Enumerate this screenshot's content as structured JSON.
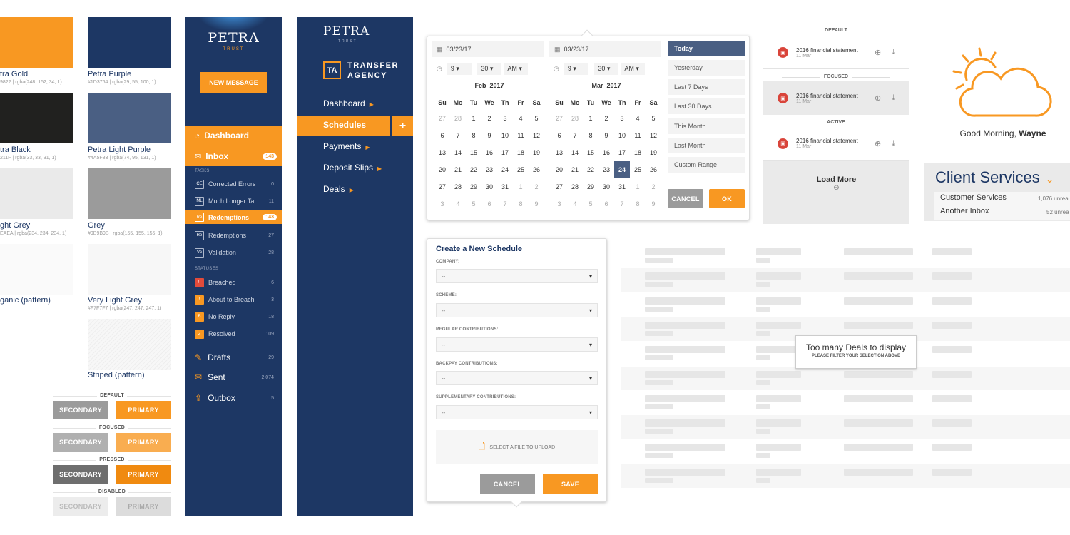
{
  "colors": {
    "gold": "#F89822",
    "purple": "#1D3764",
    "black": "#21211F",
    "light_purple": "#4A5F83",
    "light_grey": "#EAEAEA",
    "grey": "#9B9B9B",
    "very_light_grey": "#F7F7F7"
  },
  "swatches": [
    {
      "name": "tra Gold",
      "sub": "9822 | rgba(248, 152, 34, 1)"
    },
    {
      "name": "Petra Purple",
      "sub": "#1D3764 | rgba(29, 55, 100, 1)"
    },
    {
      "name": "tra Black",
      "sub": "211F | rgba(33, 33, 31, 1)"
    },
    {
      "name": "Petra Light Purple",
      "sub": "#4A5F83 | rgba(74, 95, 131, 1)"
    },
    {
      "name": "ght Grey",
      "sub": "EAEA | rgba(234, 234, 234, 1)"
    },
    {
      "name": "Grey",
      "sub": "#9B9B9B | rgba(155, 155, 155, 1)"
    },
    {
      "name": "ganic (pattern)"
    },
    {
      "name": "Very Light Grey",
      "sub": "#F7F7F7 | rgba(247, 247, 247, 1)"
    },
    {
      "name": "Striped (pattern)"
    }
  ],
  "buttons": {
    "states": [
      "DEFAULT",
      "FOCUSED",
      "PRESSED",
      "DISABLED"
    ],
    "secondary": "SECONDARY",
    "primary": "PRIMARY"
  },
  "sidebar1": {
    "logo": "PETRA",
    "logo_sub": "TRUST",
    "new_message": "NEW MESSAGE",
    "dashboard": "Dashboard",
    "inbox": "Inbox",
    "inbox_count": "143",
    "tasks_label": "TASKS",
    "statuses_label": "STATUSES",
    "tasks": [
      {
        "icon": "CE",
        "label": "Corrected Errors",
        "count": "0"
      },
      {
        "icon": "ML",
        "label": "Much Longer Ta",
        "count": "11"
      },
      {
        "icon": "Re",
        "label": "Redemptions",
        "count": "143",
        "active": true
      },
      {
        "icon": "Re",
        "label": "Redemptions",
        "count": "27"
      },
      {
        "icon": "Va",
        "label": "Validation",
        "count": "28"
      }
    ],
    "statuses": [
      {
        "icon": "!!",
        "label": "Breached",
        "count": "6",
        "color": "#e24b3b"
      },
      {
        "icon": "!",
        "label": "About to Breach",
        "count": "3",
        "color": "#F89822"
      },
      {
        "icon": "B",
        "label": "No Reply",
        "count": "18",
        "color": "#F89822"
      },
      {
        "icon": "✓",
        "label": "Resolved",
        "count": "109",
        "color": "#F89822"
      }
    ],
    "folders": [
      {
        "label": "Drafts",
        "count": "29"
      },
      {
        "label": "Sent",
        "count": "2,074"
      },
      {
        "label": "Outbox",
        "count": "5"
      }
    ]
  },
  "sidebar2": {
    "logo": "PETRA",
    "logo_sub": "TRUST",
    "ta": "TA",
    "agency1": "TRANSFER",
    "agency2": "AGENCY",
    "items": [
      "Dashboard",
      "Schedules",
      "Payments",
      "Deposit Slips",
      "Deals"
    ],
    "plus": "+"
  },
  "calendar": {
    "date1": "03/23/17",
    "date2": "03/23/17",
    "hour": "9",
    "minute": "30",
    "ampm": "AM",
    "month1": "Feb  2017",
    "month2": "Mar  2017",
    "days": [
      "Su",
      "Mo",
      "Tu",
      "We",
      "Th",
      "Fr",
      "Sa"
    ],
    "grid1": [
      [
        "27",
        "28",
        "1",
        "2",
        "3",
        "4",
        "5"
      ],
      [
        "6",
        "7",
        "8",
        "9",
        "10",
        "11",
        "12"
      ],
      [
        "13",
        "14",
        "15",
        "16",
        "17",
        "18",
        "19"
      ],
      [
        "20",
        "21",
        "22",
        "23",
        "24",
        "25",
        "26"
      ],
      [
        "27",
        "28",
        "29",
        "30",
        "31",
        "1",
        "2"
      ],
      [
        "3",
        "4",
        "5",
        "6",
        "7",
        "8",
        "9"
      ]
    ],
    "grid2": [
      [
        "27",
        "28",
        "1",
        "2",
        "3",
        "4",
        "5"
      ],
      [
        "6",
        "7",
        "8",
        "9",
        "10",
        "11",
        "12"
      ],
      [
        "13",
        "14",
        "15",
        "16",
        "17",
        "18",
        "19"
      ],
      [
        "20",
        "21",
        "22",
        "23",
        "24",
        "25",
        "26"
      ],
      [
        "27",
        "28",
        "29",
        "30",
        "31",
        "1",
        "2"
      ],
      [
        "3",
        "4",
        "5",
        "6",
        "7",
        "8",
        "9"
      ]
    ],
    "selected": "24",
    "ranges": [
      "Today",
      "Yesterday",
      "Last 7 Days",
      "Last 30 Days",
      "This Month",
      "Last Month",
      "Custom Range"
    ],
    "cancel": "CANCEL",
    "ok": "OK"
  },
  "schedule": {
    "title": "Create a New Schedule",
    "fields": [
      {
        "label": "COMPANY:",
        "value": "--"
      },
      {
        "label": "SCHEME:",
        "value": "--"
      },
      {
        "label": "REGULAR CONTRIBUTIONS:",
        "value": "--"
      },
      {
        "label": "BACKPAY CONTRIBUTIONS:",
        "value": "--"
      },
      {
        "label": "SUPPLEMENTARY CONTRIBUTIONS:",
        "value": "--"
      }
    ],
    "upload": "SELECT A FILE TO UPLOAD",
    "cancel": "CANCEL",
    "save": "SAVE"
  },
  "files": {
    "states": [
      "DEFAULT",
      "FOCUSED",
      "ACTIVE"
    ],
    "name": "2016 financial statement",
    "date": "11 Mar",
    "load_more": "Load More"
  },
  "greeting": {
    "text": "Good Morning, ",
    "name": "Wayne"
  },
  "client": {
    "title": "Client Services",
    "items": [
      {
        "label": "Customer Services",
        "count": "1,076 unrea"
      },
      {
        "label": "Another Inbox",
        "count": "52 unrea"
      }
    ]
  },
  "deals": {
    "message": "Too many Deals to display",
    "sub": "PLEASE FILTER YOUR SELECTION ABOVE"
  }
}
